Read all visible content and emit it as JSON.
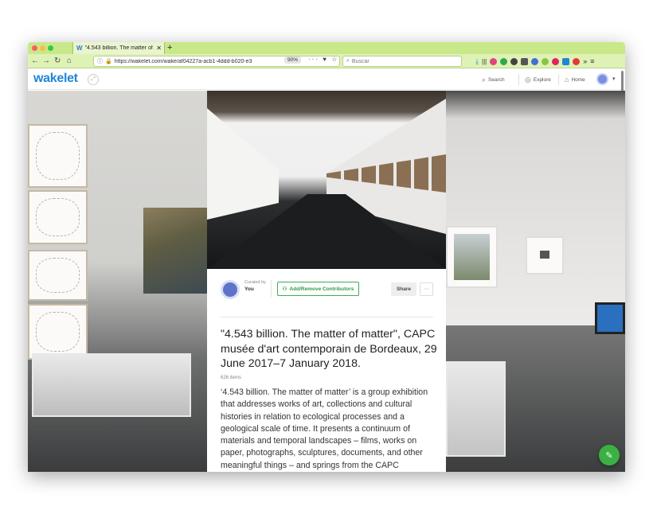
{
  "browser": {
    "tab_title": "\"4.543 billion. The matter of m",
    "tab_favicon": "W",
    "new_tab": "+",
    "url": "https://wakelet.com/wake/af04227a-acb1-4ddd-b020-e3",
    "zoom": "90%",
    "search_placeholder": "Buscar",
    "page_actions": "··· ♥ ☆"
  },
  "header": {
    "logo": "wakelet",
    "nav": [
      {
        "label": "Search",
        "icon": "search-icon"
      },
      {
        "label": "Explore",
        "icon": "compass-icon"
      },
      {
        "label": "Home",
        "icon": "home-icon"
      }
    ],
    "menu_caret": "▾"
  },
  "card": {
    "curated_label": "Curated by",
    "curated_by": "You",
    "contributors_button": "Add/Remove Contributors",
    "share_button": "Share",
    "more_button": "···",
    "title": "\"4.543 billion. The matter of matter\", CAPC musée d'art contemporain de Bordeaux, 29 June 2017–7 January 2018.",
    "item_count": "626 items",
    "description": "‘4.543 billion. The matter of matter’ is a group exhibition that addresses works of art, collections and cultural histories in relation to ecological processes and a geological scale of time. It presents a continuum of materials and temporal landscapes – films, works on paper, photographs, sculptures, documents, and other meaningful things – and springs from the CAPC"
  },
  "colors": {
    "brand": "#1f86d8",
    "accent_green": "#3bb143",
    "tab_bar": "#c9e88a"
  }
}
